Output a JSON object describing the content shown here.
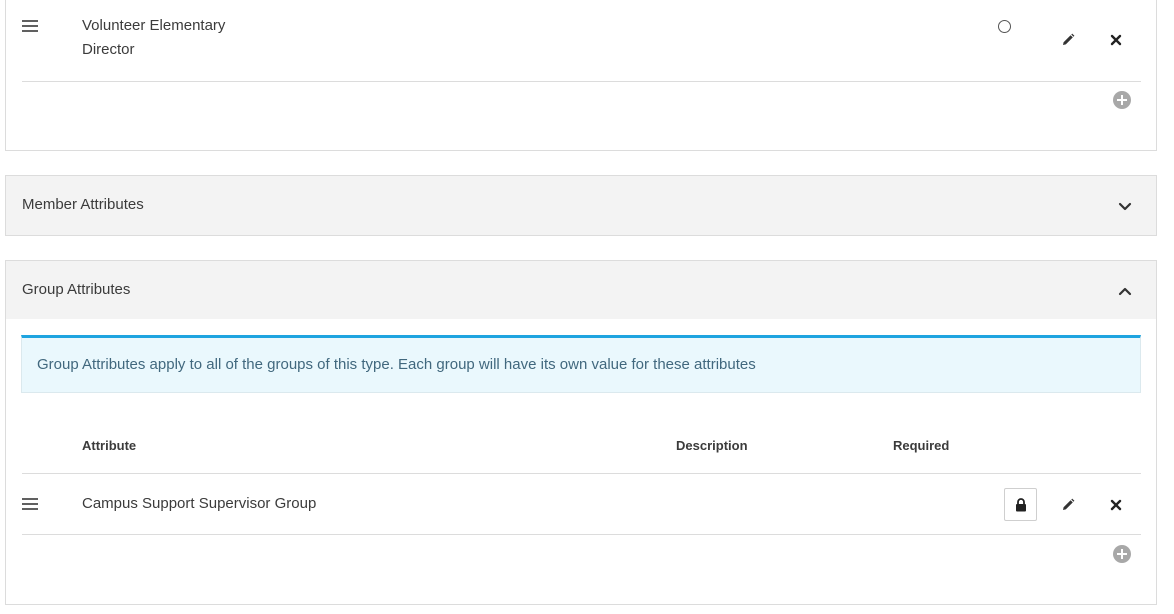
{
  "group_type_roles": {
    "rows": [
      {
        "name": "Volunteer Elementary Director"
      }
    ],
    "name_line1": "Volunteer Elementary",
    "name_line2": "Director"
  },
  "member_attributes": {
    "title": "Member Attributes"
  },
  "group_attributes": {
    "title": "Group Attributes",
    "info": "Group Attributes apply to all of the groups of this type. Each group will have its own value for these attributes",
    "columns": {
      "attribute": "Attribute",
      "description": "Description",
      "required": "Required"
    },
    "rows": [
      {
        "attribute": "Campus Support Supervisor Group",
        "description": "",
        "required": ""
      }
    ]
  },
  "icons": {
    "reorder": "reorder-bars-icon",
    "edit": "pencil-icon",
    "delete": "close-icon",
    "add": "plus-circle-icon",
    "lock": "lock-icon",
    "expand": "chevron-down-icon",
    "collapse": "chevron-up-icon",
    "radio": "radio-empty-icon"
  },
  "colors": {
    "info_border": "#1ea4e0",
    "info_background": "#eaf8fd",
    "info_text": "#41687e",
    "panel_header": "#f3f3f3"
  }
}
